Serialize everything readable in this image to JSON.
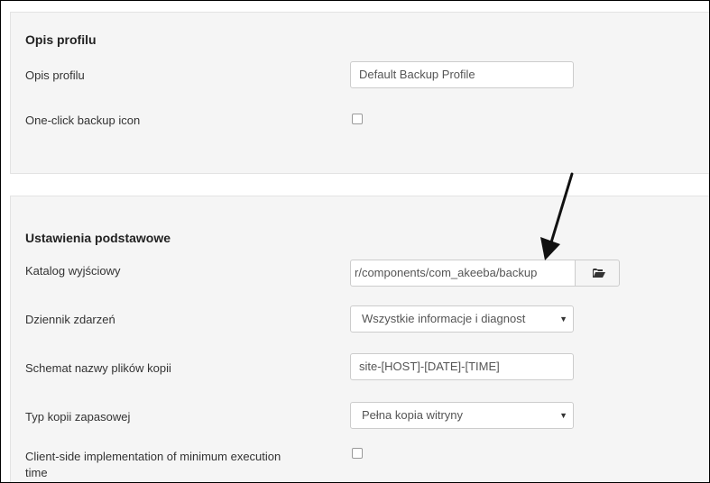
{
  "profile_section": {
    "title": "Opis profilu",
    "description_label": "Opis profilu",
    "description_value": "Default Backup Profile",
    "one_click_label": "One-click backup icon",
    "one_click_checked": false
  },
  "basic_section": {
    "title": "Ustawienia podstawowe",
    "output_dir_label": "Katalog wyjściowy",
    "output_dir_value": "​r/components/com_akeeba/backup",
    "log_label": "Dziennik zdarzeń",
    "log_value": "Wszystkie informacje i diagnost",
    "archive_name_label": "Schemat nazwy plików kopii",
    "archive_name_value": "site-[HOST]-[DATE]-[TIME]",
    "backup_type_label": "Typ kopii zapasowej",
    "backup_type_value": "Pełna kopia witryny",
    "client_side_label_line1": "Client-side implementation of minimum execution",
    "client_side_label_line2": "time",
    "client_side_checked": false
  },
  "icons": {
    "folder": "folder-open-icon",
    "caret": "caret-down-icon",
    "annotation": "arrow-annotation-icon"
  },
  "colors": {
    "panel_bg": "#f5f5f5",
    "border": "#cccccc",
    "text": "#333333"
  }
}
